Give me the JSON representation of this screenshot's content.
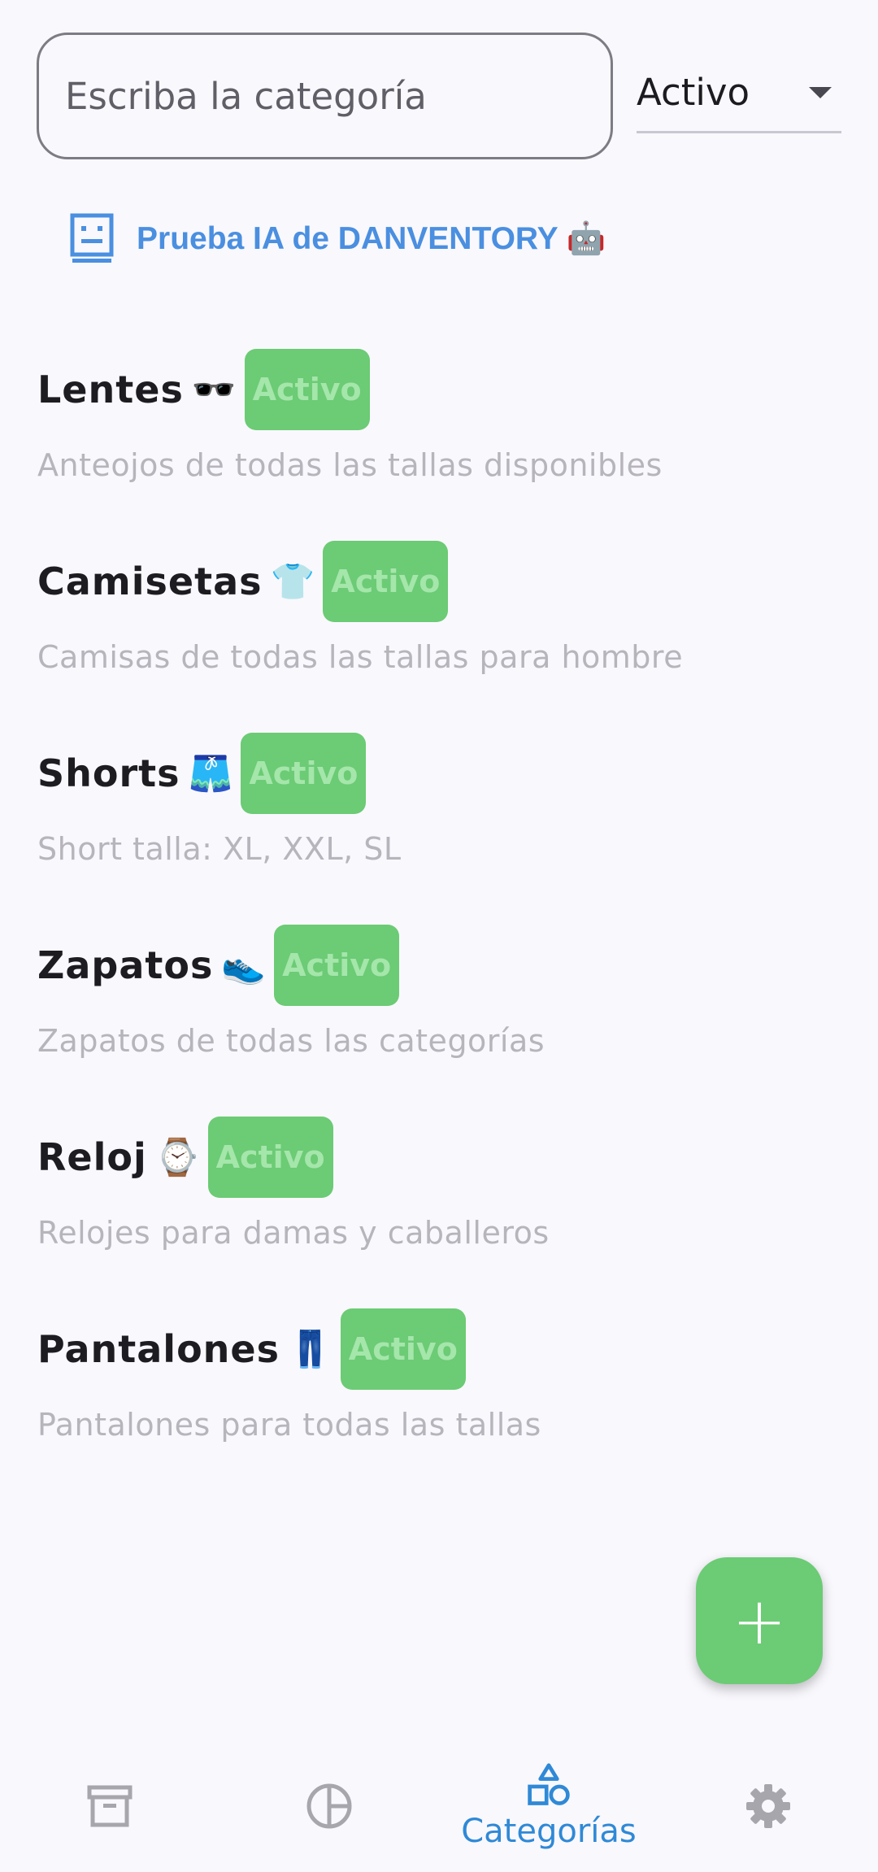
{
  "search": {
    "placeholder": "Escriba la categoría",
    "value": ""
  },
  "status_filter": {
    "value": "Activo"
  },
  "ai_link": {
    "label": "Prueba IA de DANVENTORY 🤖"
  },
  "categories": [
    {
      "title": "Lentes",
      "emoji": "🕶️",
      "badge": "Activo",
      "description": "Anteojos de todas las tallas disponibles"
    },
    {
      "title": "Camisetas",
      "emoji": "👕",
      "badge": "Activo",
      "description": "Camisas de todas las tallas para hombre"
    },
    {
      "title": "Shorts",
      "emoji": "🩳",
      "badge": "Activo",
      "description": "Short talla: XL, XXL, SL"
    },
    {
      "title": "Zapatos",
      "emoji": "👟",
      "badge": "Activo",
      "description": "Zapatos de todas las categorías"
    },
    {
      "title": "Reloj",
      "emoji": "⌚",
      "badge": "Activo",
      "description": "Relojes para damas y caballeros"
    },
    {
      "title": "Pantalones",
      "emoji": "👖",
      "badge": "Activo",
      "description": "Pantalones para todas las tallas"
    }
  ],
  "fab": {
    "symbol": "+"
  },
  "nav": {
    "items": [
      {
        "icon": "archive-icon",
        "label": ""
      },
      {
        "icon": "pie-chart-icon",
        "label": ""
      },
      {
        "icon": "shapes-icon",
        "label": "Categorías"
      },
      {
        "icon": "gear-icon",
        "label": ""
      }
    ],
    "active_index": 2
  },
  "colors": {
    "accent_blue": "#2f89d6",
    "link_blue": "#4a8fe0",
    "badge_green": "#6ccb75",
    "badge_text": "#a5e6ab",
    "background": "#f9f8fd"
  }
}
